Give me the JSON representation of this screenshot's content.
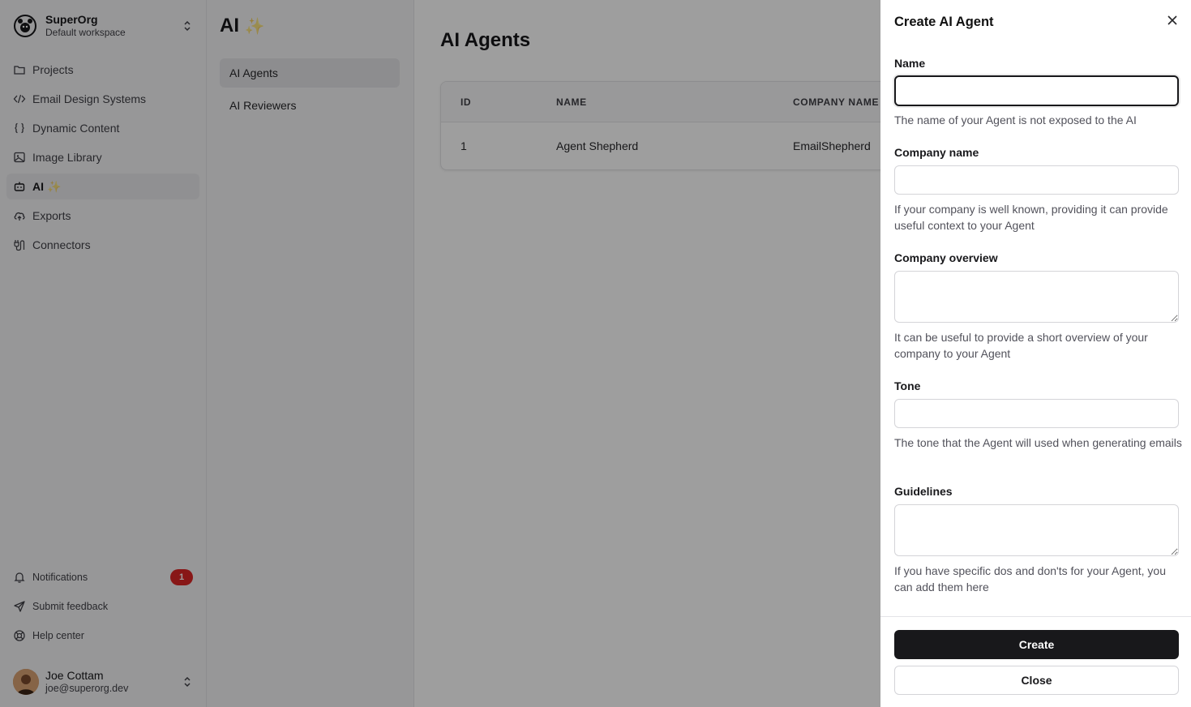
{
  "org": {
    "name": "SuperOrg",
    "workspace": "Default workspace"
  },
  "sidebar": {
    "items": [
      {
        "label": "Projects",
        "icon": "folder-icon"
      },
      {
        "label": "Email Design Systems",
        "icon": "code-icon"
      },
      {
        "label": "Dynamic Content",
        "icon": "braces-icon"
      },
      {
        "label": "Image Library",
        "icon": "image-icon"
      },
      {
        "label": "AI",
        "icon": "bot-icon",
        "suffix": "✨",
        "active": true
      },
      {
        "label": "Exports",
        "icon": "cloud-upload-icon"
      },
      {
        "label": "Connectors",
        "icon": "cable-icon"
      }
    ],
    "footer": [
      {
        "label": "Notifications",
        "icon": "bell-icon",
        "badge": "1"
      },
      {
        "label": "Submit feedback",
        "icon": "send-icon"
      },
      {
        "label": "Help center",
        "icon": "life-buoy-icon"
      }
    ]
  },
  "user": {
    "name": "Joe Cottam",
    "email": "joe@superorg.dev"
  },
  "subnav": {
    "title": "AI",
    "title_suffix": "✨",
    "items": [
      {
        "label": "AI Agents",
        "active": true
      },
      {
        "label": "AI Reviewers",
        "active": false
      }
    ]
  },
  "main": {
    "title": "AI Agents",
    "table": {
      "headers": [
        "ID",
        "NAME",
        "COMPANY NAME"
      ],
      "rows": [
        [
          "1",
          "Agent Shepherd",
          "EmailShepherd"
        ]
      ]
    }
  },
  "drawer": {
    "title": "Create AI Agent",
    "fields": {
      "name": {
        "label": "Name",
        "value": "",
        "help": "The name of your Agent is not exposed to the AI"
      },
      "company_name": {
        "label": "Company name",
        "value": "",
        "help": "If your company is well known, providing it can provide useful context to your Agent"
      },
      "company_overview": {
        "label": "Company overview",
        "value": "",
        "help": "It can be useful to provide a short overview of your company to your Agent"
      },
      "tone": {
        "label": "Tone",
        "value": "",
        "help": "The tone that the Agent will used when generating emails"
      },
      "guidelines": {
        "label": "Guidelines",
        "value": "",
        "help": "If you have specific dos and don'ts for your Agent, you can add them here"
      }
    },
    "create_label": "Create",
    "close_label": "Close"
  },
  "colors": {
    "overlay": "#000000",
    "primary": "#18181b",
    "badge": "#dc2626"
  }
}
